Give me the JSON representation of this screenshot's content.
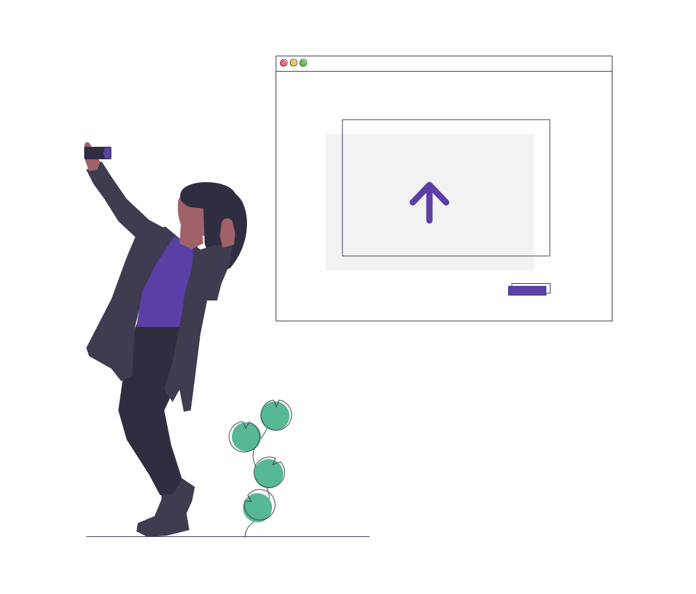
{
  "illustration": {
    "subject": "person-taking-selfie-beside-upload-window",
    "icons": [
      "close-dot-icon",
      "minimize-dot-icon",
      "maximize-dot-icon",
      "upload-arrow-icon",
      "plant-icon"
    ],
    "colors": {
      "accent": "#5a3fa6",
      "coat": "#3f3b51",
      "pants": "#2f2e41",
      "skin": "#a0616a",
      "hair": "#2f2e41",
      "leaf": "#57b894",
      "panel": "#f2f2f2",
      "line": "#3f3d56",
      "dot_close": "#ef6a75",
      "dot_minimize": "#f5c84b",
      "dot_maximize": "#68c44b"
    }
  }
}
